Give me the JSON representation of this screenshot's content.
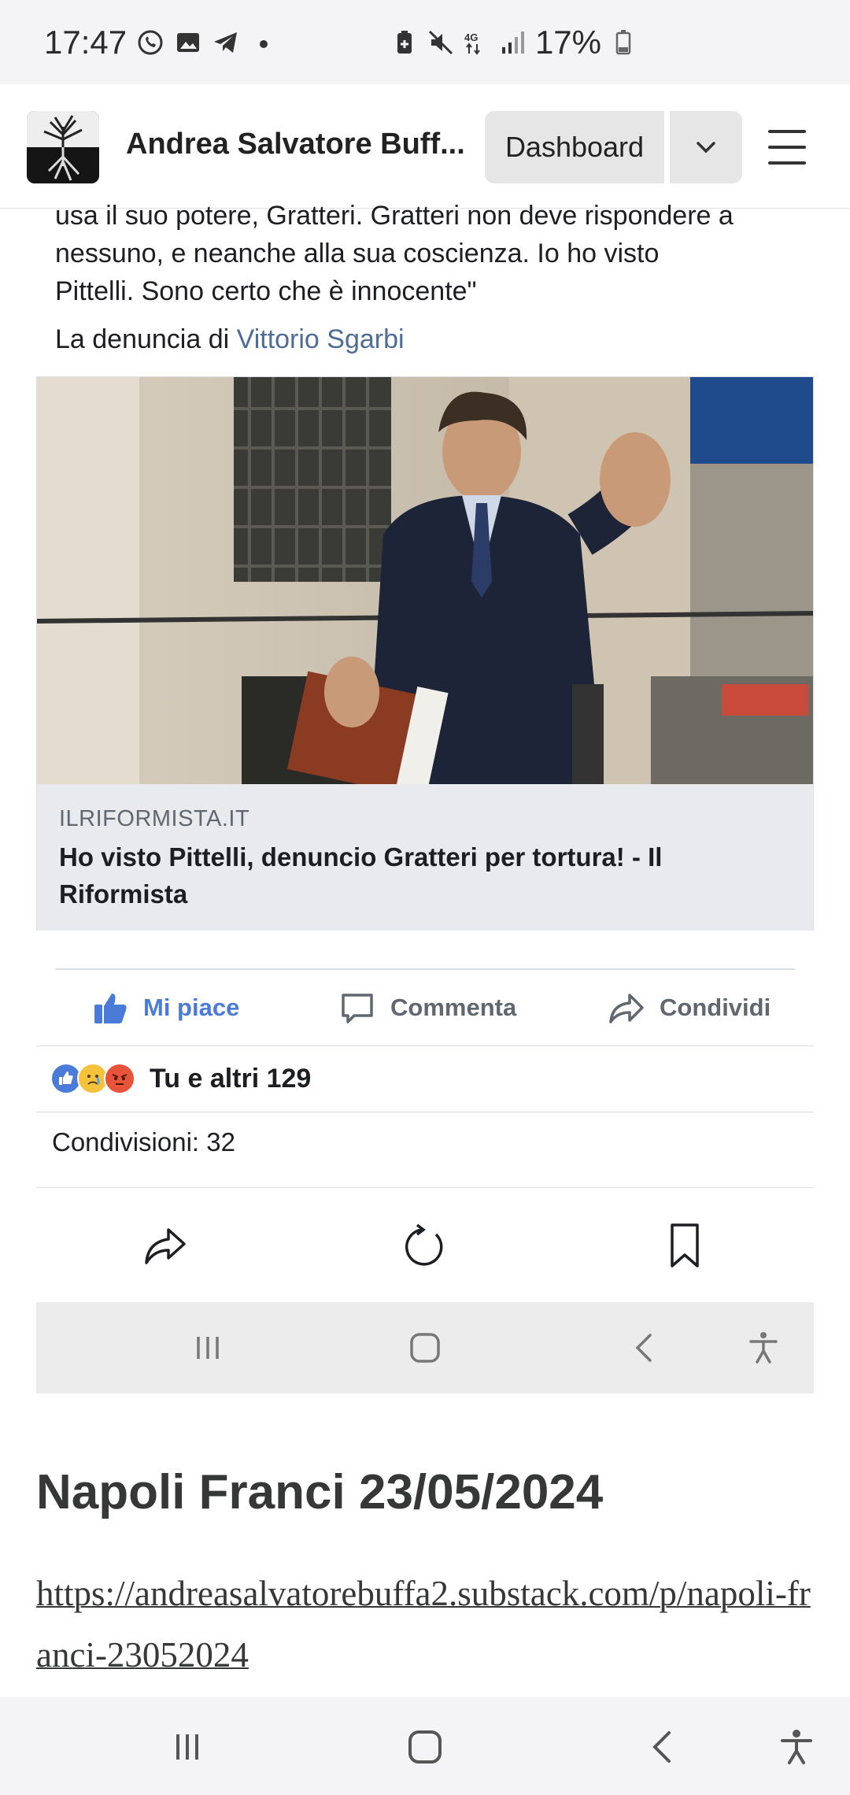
{
  "status_bar": {
    "time": "17:47",
    "battery": "17%",
    "network": "4G+"
  },
  "header": {
    "site_title": "Andrea Salvatore Buff...",
    "dashboard_label": "Dashboard"
  },
  "post": {
    "text_lines": [
      "usa il suo potere, Gratteri. Gratteri non deve rispondere a",
      "nessuno, e neanche alla sua coscienza. Io ho visto",
      "Pittelli. Sono certo che è innocente\""
    ],
    "denuncia_prefix": "La denuncia di ",
    "denuncia_author": "Vittorio Sgarbi",
    "link": {
      "domain": "ILRIFORMISTA.IT",
      "title": "Ho visto Pittelli, denuncio Gratteri per tortura! - Il Riformista"
    },
    "actions": {
      "like": "Mi piace",
      "comment": "Commenta",
      "share": "Condividi"
    },
    "reactions_text": "Tu e altri 129",
    "shares_text": "Condivisioni: 32"
  },
  "article": {
    "title": "Napoli Franci 23/05/2024",
    "url": "https://andreasalvatorebuffa2.substack.com/p/napoli-franci-23052024"
  },
  "colors": {
    "accent_blue": "#4b7bd8",
    "link_blue": "#4d6d96",
    "text_dark": "#1c1e21",
    "muted": "#606770"
  }
}
